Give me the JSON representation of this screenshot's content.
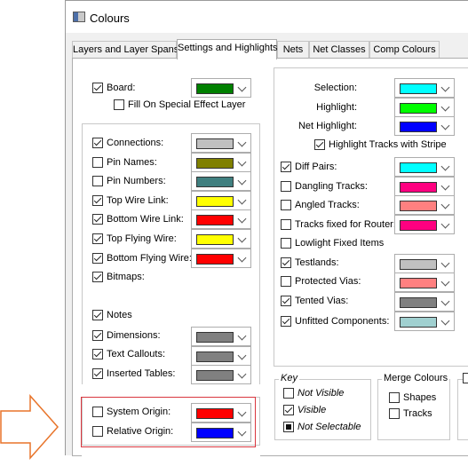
{
  "window": {
    "title": "Colours"
  },
  "tabs": [
    {
      "label": "Layers and Layer Spans"
    },
    {
      "label": "Settings and Highlights"
    },
    {
      "label": "Nets"
    },
    {
      "label": "Net Classes"
    },
    {
      "label": "Comp Colours"
    }
  ],
  "left": {
    "board": {
      "label": "Board:",
      "checked": true,
      "color": "#008000"
    },
    "fill_special": {
      "label": "Fill On Special Effect Layer",
      "checked": false
    },
    "items": [
      {
        "label": "Connections:",
        "checked": true,
        "color": "#c0c0c0"
      },
      {
        "label": "Pin Names:",
        "checked": false,
        "color": "#808000"
      },
      {
        "label": "Pin Numbers:",
        "checked": false,
        "color": "#3f7f7f"
      },
      {
        "label": "Top Wire Link:",
        "checked": true,
        "color": "#ffff00"
      },
      {
        "label": "Bottom Wire Link:",
        "checked": true,
        "color": "#ff0000"
      },
      {
        "label": "Top Flying Wire:",
        "checked": true,
        "color": "#ffff00"
      },
      {
        "label": "Bottom Flying Wire:",
        "checked": true,
        "color": "#ff0000"
      },
      {
        "label": "Bitmaps:",
        "checked": true
      }
    ],
    "items2": [
      {
        "label": "Notes",
        "checked": true
      },
      {
        "label": "Dimensions:",
        "checked": true,
        "color": "#808080"
      },
      {
        "label": "Text Callouts:",
        "checked": true,
        "color": "#808080"
      },
      {
        "label": "Inserted Tables:",
        "checked": true,
        "color": "#808080"
      }
    ],
    "origins": [
      {
        "label": "System Origin:",
        "checked": false,
        "color": "#ff0000"
      },
      {
        "label": "Relative Origin:",
        "checked": false,
        "color": "#0000ff"
      }
    ]
  },
  "right": {
    "highlights": [
      {
        "label": "Selection:",
        "color": "#00ffff"
      },
      {
        "label": "Highlight:",
        "color": "#00ff00"
      },
      {
        "label": "Net Highlight:",
        "color": "#0000ff"
      }
    ],
    "stripe": {
      "label": "Highlight Tracks with Stripe",
      "checked": true
    },
    "items": [
      {
        "label": "Diff Pairs:",
        "checked": true,
        "color": "#00ffff"
      },
      {
        "label": "Dangling Tracks:",
        "checked": false,
        "color": "#ff0080"
      },
      {
        "label": "Angled Tracks:",
        "checked": false,
        "color": "#ff8080"
      },
      {
        "label": "Tracks fixed for Router:",
        "checked": false,
        "color": "#ff0080"
      },
      {
        "label": "Lowlight Fixed Items",
        "checked": false
      },
      {
        "label": "Testlands:",
        "checked": true,
        "color": "#c0c0c0"
      },
      {
        "label": "Protected Vias:",
        "checked": false,
        "color": "#ff8080"
      },
      {
        "label": "Tented Vias:",
        "checked": true,
        "color": "#808080"
      },
      {
        "label": "Unfitted Components:",
        "checked": true,
        "color": "#a0d0d0"
      }
    ]
  },
  "key": {
    "title": "Key",
    "items": [
      {
        "label": "Not Visible",
        "state": "unchecked"
      },
      {
        "label": "Visible",
        "state": "checked"
      },
      {
        "label": "Not Selectable",
        "state": "filled"
      }
    ]
  },
  "merge": {
    "title": "Merge Colours",
    "items": [
      {
        "label": "Shapes",
        "checked": false
      },
      {
        "label": "Tracks",
        "checked": false
      }
    ]
  },
  "accents": {
    "annotation_red": "#d9363e",
    "arrow_orange": "#e8742a"
  }
}
